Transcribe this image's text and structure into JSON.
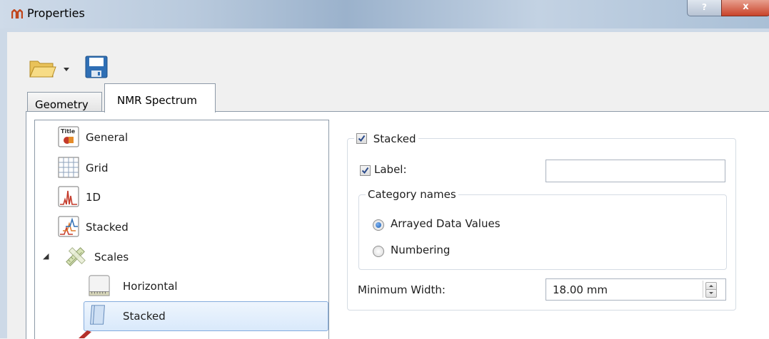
{
  "window": {
    "title": "Properties",
    "help_label": "?",
    "close_label": "x"
  },
  "toolbar": {
    "open_icon": "folder-open-icon",
    "dropdown_icon": "chevron-down-icon",
    "save_icon": "floppy-disk-icon"
  },
  "tabs": [
    {
      "label": "Geometry",
      "active": false
    },
    {
      "label": "NMR Spectrum",
      "active": true
    }
  ],
  "tree": {
    "items": [
      {
        "label": "General",
        "icon": "title-icon"
      },
      {
        "label": "Grid",
        "icon": "grid-icon"
      },
      {
        "label": "1D",
        "icon": "spectrum-1d-icon"
      },
      {
        "label": "Stacked",
        "icon": "stacked-spectra-icon"
      },
      {
        "label": "Scales",
        "icon": "ruler-icon",
        "expander": "◢",
        "expanded": true
      },
      {
        "label": "Horizontal",
        "icon": "horizontal-scale-icon"
      },
      {
        "label": "Stacked",
        "icon": "stacked-scale-icon",
        "selected": true
      }
    ]
  },
  "stacked_group": {
    "title": "Stacked",
    "checked": true,
    "label_checkbox": {
      "label": "Label:",
      "checked": true
    },
    "label_value": "",
    "category_names": {
      "title": "Category names",
      "options": [
        {
          "label": "Arrayed Data Values",
          "selected": true
        },
        {
          "label": "Numbering",
          "selected": false
        }
      ]
    },
    "minimum_width": {
      "label": "Minimum Width:",
      "value": "18.00 mm"
    }
  },
  "colors": {
    "selection": "#d9e9fb",
    "selection_border": "#84acdd",
    "border": "#8d9aa8"
  }
}
